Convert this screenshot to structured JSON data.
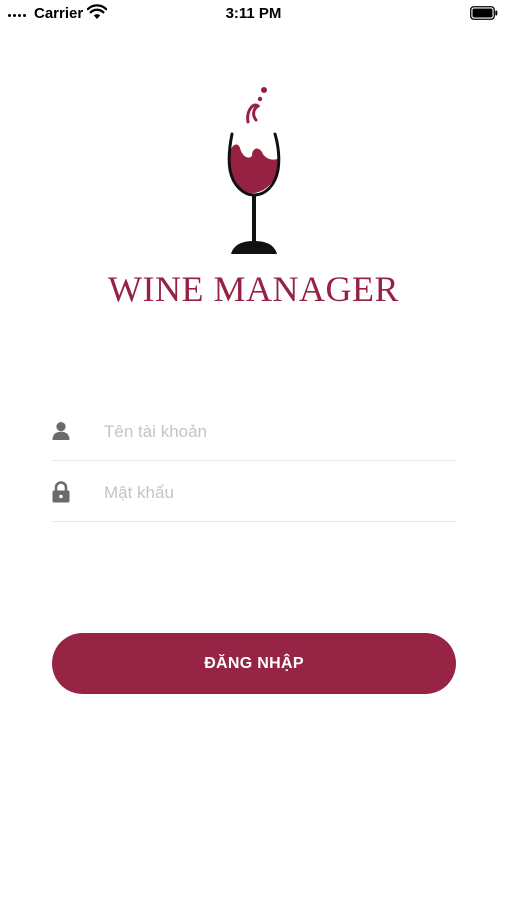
{
  "status_bar": {
    "carrier": "Carrier",
    "time": "3:11 PM",
    "icons": [
      "signal-icon",
      "wifi-icon",
      "battery-icon"
    ]
  },
  "logo": {
    "icon": "wine-glass-icon",
    "title": "WINE MANAGER"
  },
  "login_form": {
    "username": {
      "icon": "user-icon",
      "value": "",
      "placeholder": "Tên tài khoản"
    },
    "password": {
      "icon": "lock-icon",
      "value": "",
      "placeholder": "Mật khẩu"
    },
    "submit_label": "ĐĂNG NHẬP"
  },
  "colors": {
    "brand": "#962142",
    "button": "#952445",
    "placeholder": "#c4c4c4",
    "divider": "#e7e7e7",
    "icon": "#6b6b6b"
  }
}
